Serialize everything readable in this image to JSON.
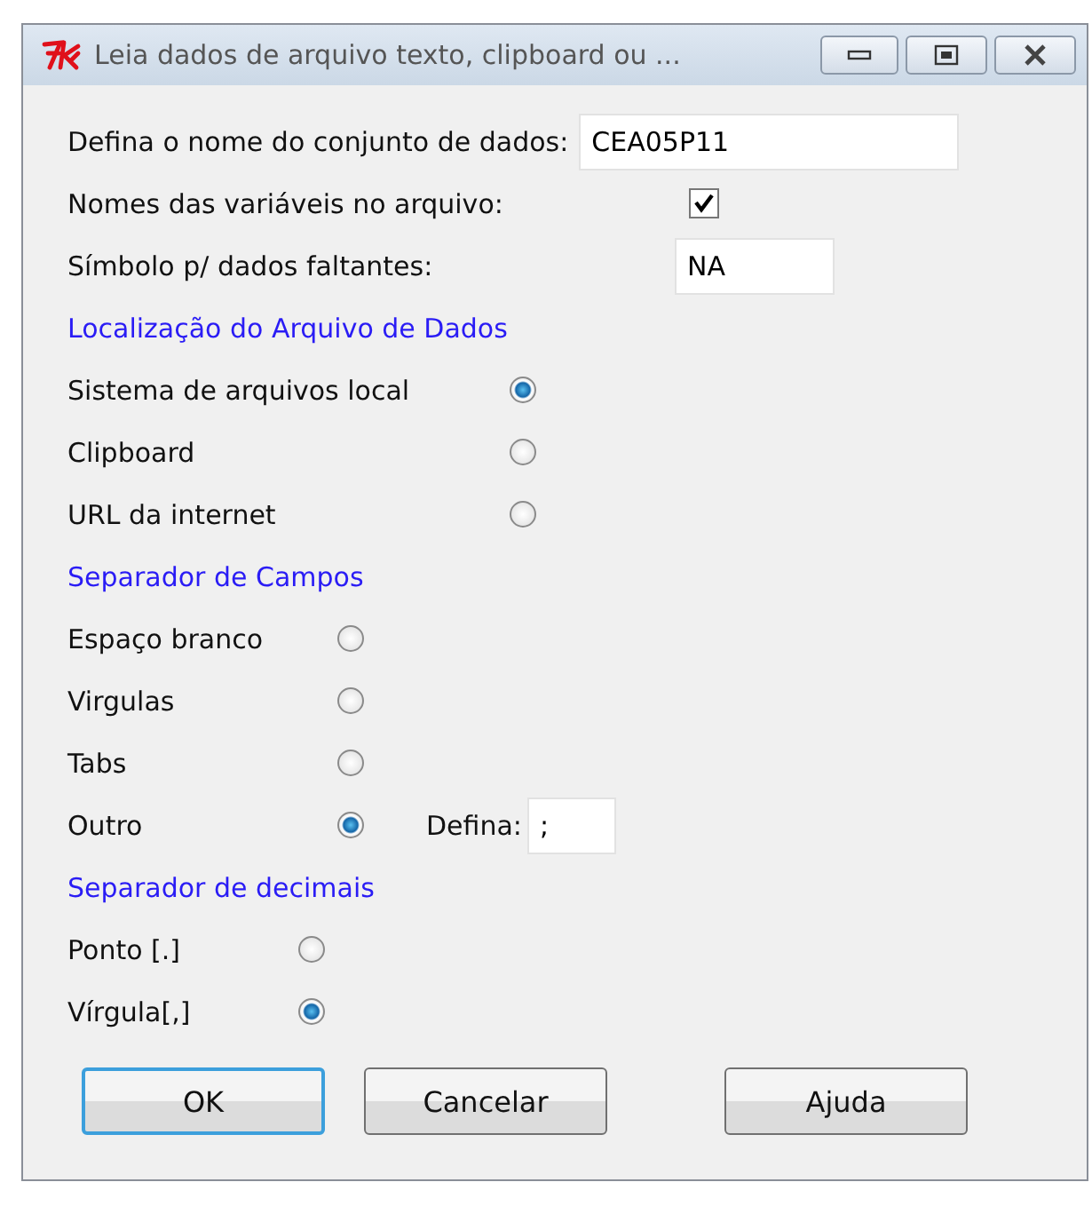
{
  "window": {
    "title": "Leia dados de arquivo texto, clipboard ou ..."
  },
  "dataset_name": {
    "label": "Defina o nome do conjunto de dados:",
    "value": "CEA05P11"
  },
  "variable_names": {
    "label": "Nomes das variáveis no arquivo:",
    "checked": true
  },
  "missing_symbol": {
    "label": "Símbolo p/ dados faltantes:",
    "value": "NA"
  },
  "groups": [
    {
      "title": "Localização do Arquivo de Dados",
      "options": [
        {
          "label": "Sistema de arquivos local",
          "selected": true
        },
        {
          "label": "Clipboard",
          "selected": false
        },
        {
          "label": "URL da internet",
          "selected": false
        }
      ]
    },
    {
      "title": "Separador de Campos",
      "options": [
        {
          "label": "Espaço branco",
          "selected": false
        },
        {
          "label": "Virgulas",
          "selected": false
        },
        {
          "label": "Tabs",
          "selected": false
        },
        {
          "label": "Outro",
          "selected": true,
          "field": {
            "label": "Defina:",
            "value": ";"
          }
        }
      ]
    },
    {
      "title": "Separador de decimais",
      "options": [
        {
          "label": "Ponto [.]",
          "selected": false
        },
        {
          "label": "Vírgula[,]",
          "selected": true
        }
      ]
    }
  ],
  "buttons": [
    {
      "label": "OK",
      "focused": true
    },
    {
      "label": "Cancelar",
      "focused": false
    },
    {
      "label": "Ajuda",
      "focused": false
    }
  ]
}
